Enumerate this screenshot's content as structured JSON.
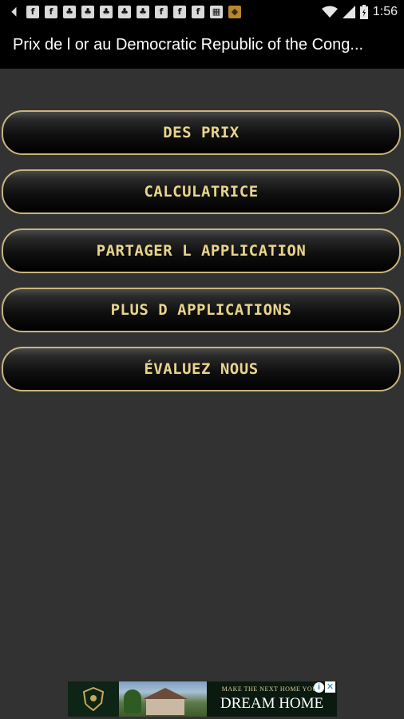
{
  "status_bar": {
    "time": "1:56",
    "left_icons": [
      "back-arrow-icon",
      "facebook-icon",
      "facebook-icon",
      "palm-tree-icon",
      "palm-tree-icon",
      "palm-tree-icon",
      "palm-tree-icon",
      "palm-tree-icon",
      "facebook-icon",
      "facebook-icon",
      "facebook-icon",
      "image-icon",
      "app-icon"
    ],
    "right_icons": [
      "wifi-icon",
      "signal-icon",
      "battery-icon"
    ]
  },
  "action_bar": {
    "title": "Prix de l or au Democratic Republic of the Cong..."
  },
  "menu": {
    "buttons": [
      {
        "label": "DES PRIX"
      },
      {
        "label": "CALCULATRICE"
      },
      {
        "label": "PARTAGER L APPLICATION"
      },
      {
        "label": "PLUS D APPLICATIONS"
      },
      {
        "label": "ÉVALUEZ NOUS"
      }
    ]
  },
  "ad": {
    "tagline": "MAKE THE NEXT HOME YOUR",
    "headline": "DREAM HOME",
    "info_glyph": "i",
    "close_glyph": "✕"
  },
  "colors": {
    "background": "#323232",
    "bar": "#000000",
    "button_border": "#c9b57e",
    "button_text": "#e9d48b"
  }
}
